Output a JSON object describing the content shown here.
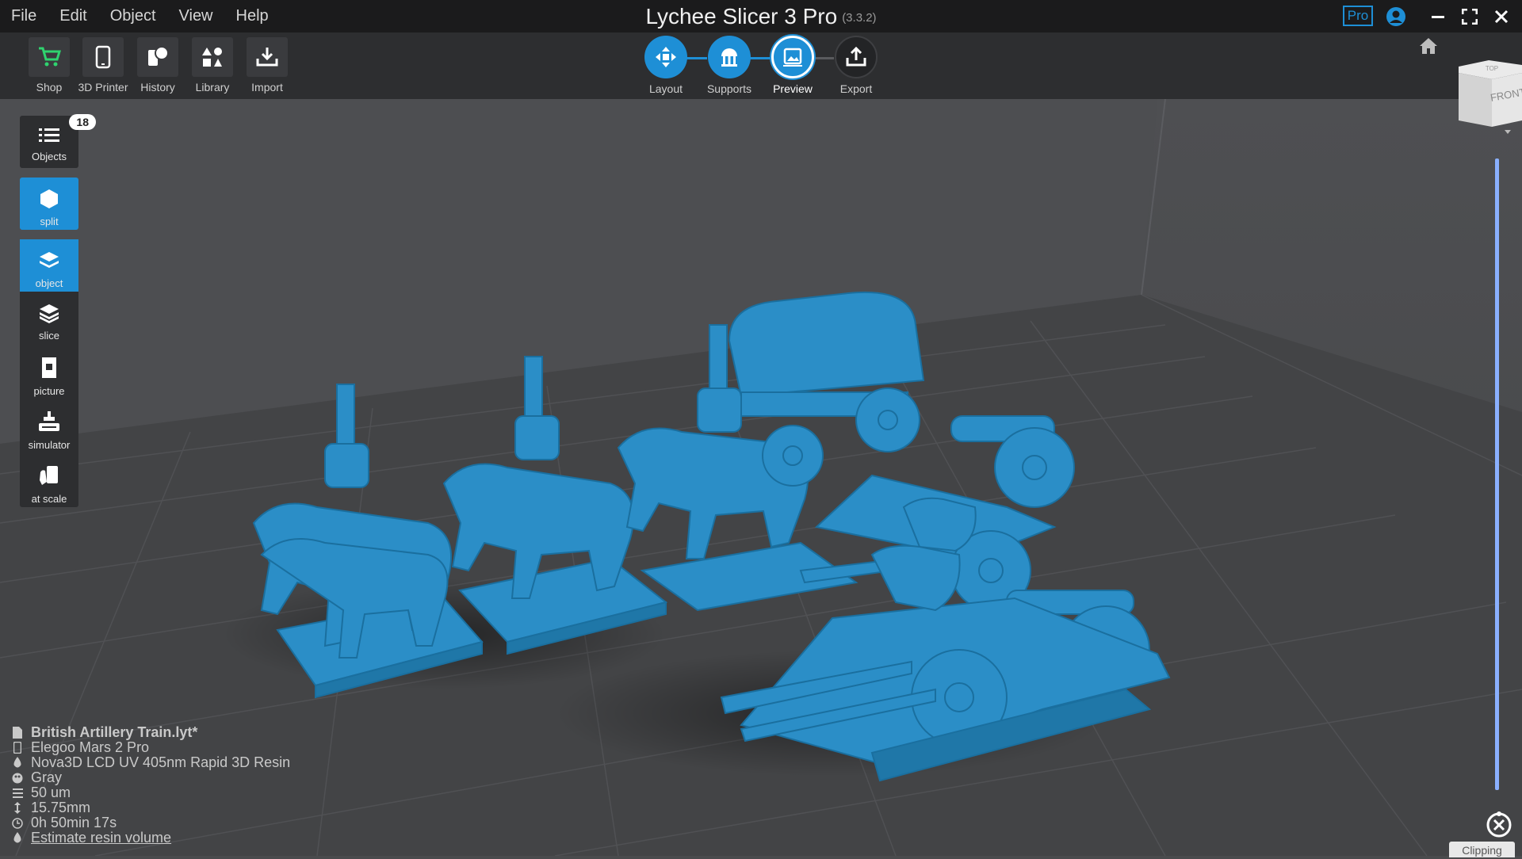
{
  "menu": [
    "File",
    "Edit",
    "Object",
    "View",
    "Help"
  ],
  "app": {
    "title": "Lychee Slicer 3 Pro",
    "version": "(3.3.2)",
    "pro_badge": "Pro"
  },
  "toolbar": {
    "tools": [
      {
        "label": "Shop",
        "icon": "cart-icon"
      },
      {
        "label": "3D Printer",
        "icon": "phone-icon"
      },
      {
        "label": "History",
        "icon": "history-icon"
      },
      {
        "label": "Library",
        "icon": "library-icon"
      },
      {
        "label": "Import",
        "icon": "import-icon"
      }
    ],
    "steps": [
      {
        "label": "Layout",
        "state": "done"
      },
      {
        "label": "Supports",
        "state": "done"
      },
      {
        "label": "Preview",
        "state": "active"
      },
      {
        "label": "Export",
        "state": "pending"
      }
    ]
  },
  "sidebar": {
    "objects_label": "Objects",
    "objects_count": "18",
    "items": [
      {
        "label": "split",
        "active": true
      },
      {
        "label": "object",
        "active": true
      },
      {
        "label": "slice",
        "active": false
      },
      {
        "label": "picture",
        "active": false
      },
      {
        "label": "simulator",
        "active": false
      },
      {
        "label": "at scale",
        "active": false
      }
    ]
  },
  "info": {
    "file": "British Artillery Train.lyt*",
    "printer": "Elegoo Mars 2 Pro",
    "resin": "Nova3D LCD UV 405nm Rapid 3D Resin",
    "color": "Gray",
    "layer": "50 um",
    "height": "15.75mm",
    "time": "0h 50min 17s",
    "estimate": "Estimate resin volume"
  },
  "viewcube": {
    "face_front": "FRONT",
    "face_top": "TOP"
  },
  "clipping_label": "Clipping",
  "colors": {
    "accent": "#1e8fd6",
    "model": "#2b8ec7",
    "bg": "#4a4b4d",
    "toolbar": "#2d2e30"
  }
}
